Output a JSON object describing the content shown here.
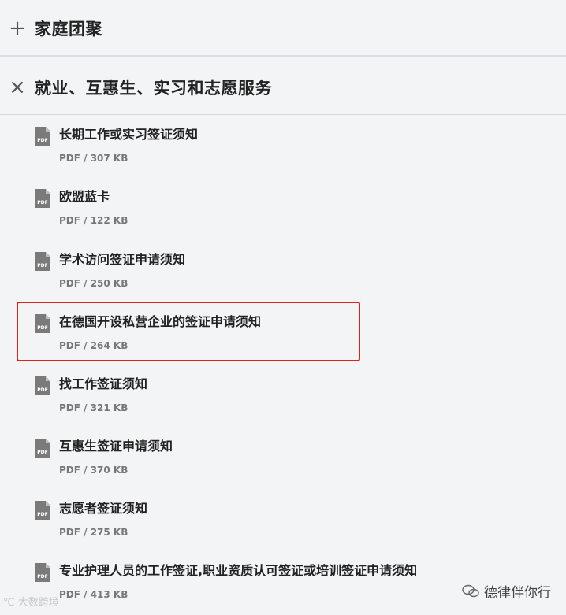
{
  "sections": [
    {
      "title": "家庭团聚",
      "toggle": "+"
    },
    {
      "title": "就业、互惠生、实习和志愿服务",
      "toggle": "×"
    }
  ],
  "documents": [
    {
      "title": "长期工作或实习签证须知",
      "meta": "PDF / 307 KB"
    },
    {
      "title": "欧盟蓝卡",
      "meta": "PDF / 122 KB"
    },
    {
      "title": "学术访问签证申请须知",
      "meta": "PDF / 250 KB"
    },
    {
      "title": "在德国开设私营企业的签证申请须知",
      "meta": "PDF / 264 KB",
      "highlighted": true
    },
    {
      "title": "找工作签证须知",
      "meta": "PDF / 321 KB"
    },
    {
      "title": "互惠生签证申请须知",
      "meta": "PDF / 370 KB"
    },
    {
      "title": "志愿者签证须知",
      "meta": "PDF / 275 KB"
    },
    {
      "title": "专业护理人员的工作签证,职业资质认可签证或培训签证申请须知",
      "meta": "PDF / 413 KB"
    }
  ],
  "icon_label": "PDF",
  "watermarks": {
    "left": "大数跨境",
    "right": "德律伴你行"
  },
  "colors": {
    "highlight": "#e2211c",
    "background": "#f3f4f6"
  }
}
